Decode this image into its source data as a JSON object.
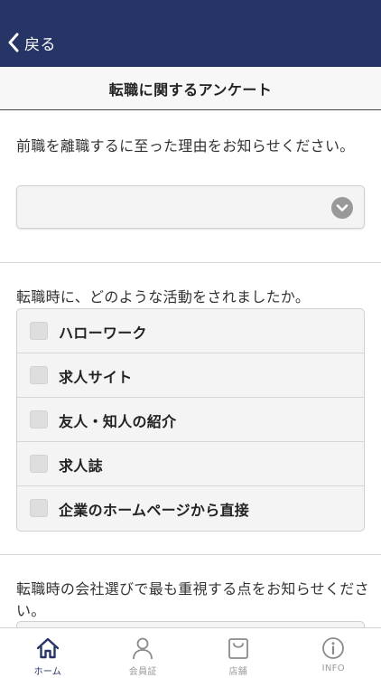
{
  "header": {
    "back_label": "戻る"
  },
  "title": "転職に関するアンケート",
  "questions": [
    {
      "text": "前職を離職するに至った理由をお知らせください。",
      "selected": ""
    },
    {
      "text": "転職時に、どのような活動をされましたか。",
      "options": [
        "ハローワーク",
        "求人サイト",
        "友人・知人の紹介",
        "求人誌",
        "企業のホームページから直接"
      ]
    },
    {
      "text": "転職時の会社選びで最も重視する点をお知らせください。"
    }
  ],
  "tabs": [
    {
      "label": "ホーム",
      "icon": "home-icon",
      "active": true
    },
    {
      "label": "会員証",
      "icon": "person-icon",
      "active": false
    },
    {
      "label": "店舗",
      "icon": "bag-icon",
      "active": false
    },
    {
      "label": "INFO",
      "icon": "info-icon",
      "active": false
    }
  ],
  "colors": {
    "header_bg": "#263566",
    "active_tab": "#263566"
  }
}
